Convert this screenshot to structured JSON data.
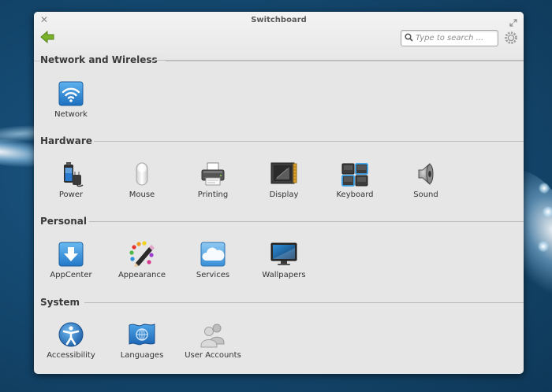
{
  "window": {
    "title": "Switchboard"
  },
  "search": {
    "placeholder": "Type to search ..."
  },
  "sections": [
    {
      "title": "Network and Wireless",
      "items": [
        {
          "label": "Network",
          "icon": "wifi-icon"
        }
      ]
    },
    {
      "title": "Hardware",
      "items": [
        {
          "label": "Power",
          "icon": "battery-icon"
        },
        {
          "label": "Mouse",
          "icon": "mouse-icon"
        },
        {
          "label": "Printing",
          "icon": "printer-icon"
        },
        {
          "label": "Display",
          "icon": "display-icon"
        },
        {
          "label": "Keyboard",
          "icon": "keyboard-icon"
        },
        {
          "label": "Sound",
          "icon": "speaker-icon"
        }
      ]
    },
    {
      "title": "Personal",
      "items": [
        {
          "label": "AppCenter",
          "icon": "appcenter-icon"
        },
        {
          "label": "Appearance",
          "icon": "palette-icon"
        },
        {
          "label": "Services",
          "icon": "cloud-icon"
        },
        {
          "label": "Wallpapers",
          "icon": "monitor-icon"
        }
      ]
    },
    {
      "title": "System",
      "items": [
        {
          "label": "Accessibility",
          "icon": "accessibility-icon"
        },
        {
          "label": "Languages",
          "icon": "globe-flag-icon"
        },
        {
          "label": "User Accounts",
          "icon": "users-icon"
        }
      ]
    }
  ],
  "colors": {
    "accent": "#2f8fd8",
    "back_arrow": "#7bb22c",
    "window_bg": "#e6e6e6"
  }
}
